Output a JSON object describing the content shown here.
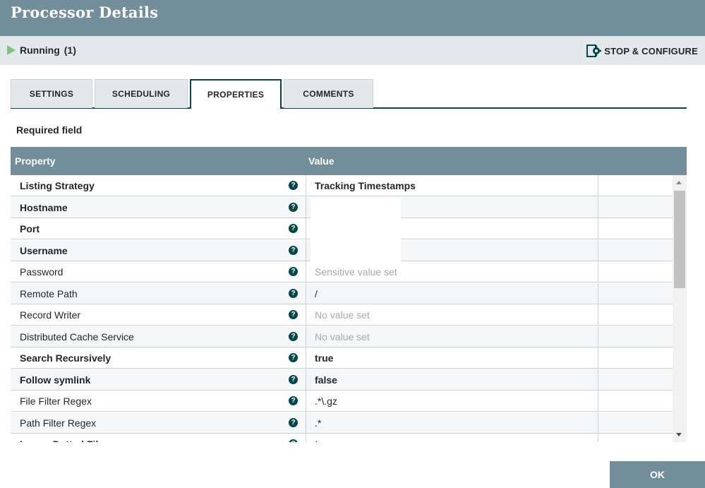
{
  "dialog": {
    "title": "Processor Details"
  },
  "status": {
    "state": "Running",
    "count": "(1)",
    "stop_configure_label": "STOP & CONFIGURE"
  },
  "tabs": [
    {
      "label": "SETTINGS",
      "active": false
    },
    {
      "label": "SCHEDULING",
      "active": false
    },
    {
      "label": "PROPERTIES",
      "active": true
    },
    {
      "label": "COMMENTS",
      "active": false
    }
  ],
  "required_field": "Required field",
  "grid": {
    "columns": [
      "Property",
      "Value"
    ],
    "rows": [
      {
        "name": "Listing Strategy",
        "value": "Tracking Timestamps",
        "required": true,
        "value_style": "bold"
      },
      {
        "name": "Hostname",
        "value": "",
        "required": true,
        "value_style": "bold"
      },
      {
        "name": "Port",
        "value": "",
        "required": true,
        "value_style": "bold"
      },
      {
        "name": "Username",
        "value": "",
        "required": true,
        "value_style": "bold"
      },
      {
        "name": "Password",
        "value": "Sensitive value set",
        "required": false,
        "value_style": "muted"
      },
      {
        "name": "Remote Path",
        "value": "/",
        "required": false,
        "value_style": "normal"
      },
      {
        "name": "Record Writer",
        "value": "No value set",
        "required": false,
        "value_style": "muted"
      },
      {
        "name": "Distributed Cache Service",
        "value": "No value set",
        "required": false,
        "value_style": "muted"
      },
      {
        "name": "Search Recursively",
        "value": "true",
        "required": true,
        "value_style": "bold"
      },
      {
        "name": "Follow symlink",
        "value": "false",
        "required": true,
        "value_style": "bold"
      },
      {
        "name": "File Filter Regex",
        "value": ".*\\.gz",
        "required": false,
        "value_style": "normal"
      },
      {
        "name": "Path Filter Regex",
        "value": ".*",
        "required": false,
        "value_style": "normal"
      },
      {
        "name": "Ignore Dotted Files",
        "value": "true",
        "required": true,
        "value_style": "bold"
      }
    ]
  },
  "ok_label": "OK",
  "colors": {
    "header": "#728e9b",
    "status_bar": "#e3e8eb",
    "accent": "#004849",
    "running": "#7dc47d"
  }
}
